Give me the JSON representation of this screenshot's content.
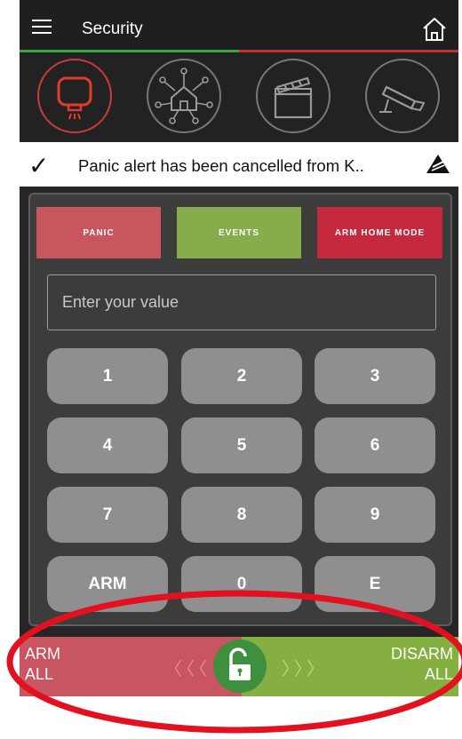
{
  "app": {
    "title": "Security"
  },
  "icons": {
    "menu": "hamburger-menu-icon",
    "home": "home-icon",
    "categories": [
      "siren-alarm-icon",
      "smart-home-network-icon",
      "clapperboard-scenes-icon",
      "security-camera-icon"
    ],
    "status": "checkmark-icon",
    "alert": "alert-triangle-icon",
    "slider_knob": "unlocked-padlock-icon"
  },
  "progress": {
    "fraction": 0.5
  },
  "status": {
    "check": "✓",
    "message": "Panic alert has been cancelled from K.."
  },
  "actions": {
    "panic": "PANIC",
    "events": "EVENTS",
    "arm_home": "ARM HOME MODE"
  },
  "input": {
    "placeholder": "Enter your value",
    "value": ""
  },
  "keypad": {
    "k1": "1",
    "k2": "2",
    "k3": "3",
    "k4": "4",
    "k5": "5",
    "k6": "6",
    "k7": "7",
    "k8": "8",
    "k9": "9",
    "karm": "ARM",
    "k0": "0",
    "ke": "E"
  },
  "slider": {
    "left_line1": "ARM",
    "left_line2": "ALL",
    "right_line1": "DISARM",
    "right_line2": "ALL",
    "left_chevrons": "〈〈〈",
    "right_chevrons": "〉〉〉"
  },
  "colors": {
    "panic": "#c9555f",
    "events": "#86ad4b",
    "arm_home": "#c4293d",
    "arm_all": "#c85560",
    "disarm_all": "#85b041",
    "knob": "#3e8f3e",
    "progress_green": "#3ea547",
    "progress_red": "#c0303a",
    "annotation_ring": "#e3111f"
  }
}
